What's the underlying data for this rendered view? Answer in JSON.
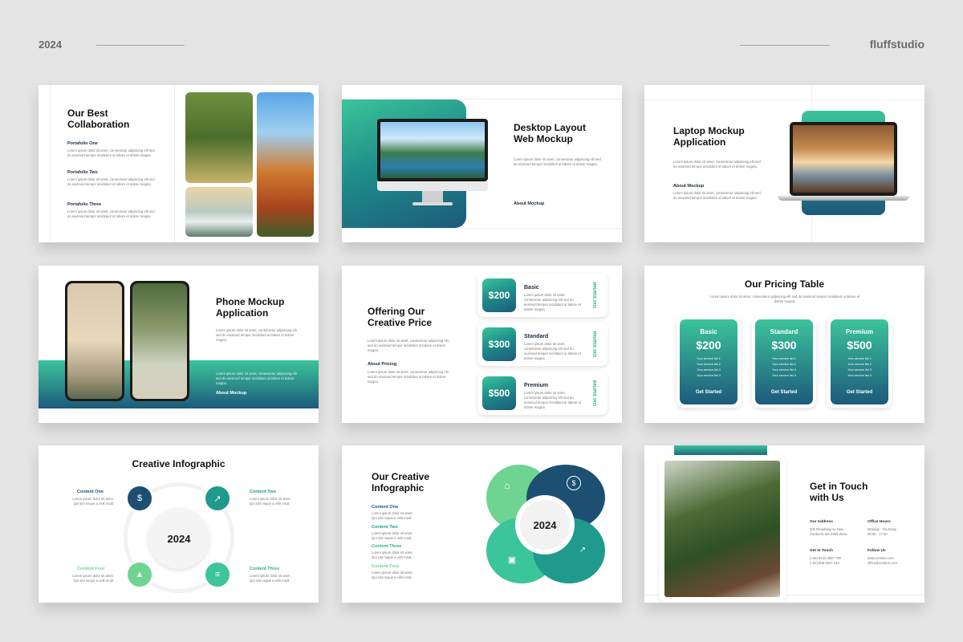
{
  "header": {
    "year": "2024",
    "brand": "fluffstudio"
  },
  "colors": {
    "teal": "#1f8f8a",
    "green": "#3cc49b",
    "navy": "#1d4f73",
    "light_green": "#6fd391"
  },
  "lorem": {
    "short": "Lorem ipsum dolor sit amet, consectetur adipiscing elit sed do eiusmod tempor incididunt ut labore et dolore magna.",
    "two": "Lorem ipsum dolor sit amet.\nQui sint neque a velit modi."
  },
  "s1": {
    "title": "Our Best\nCollaboration",
    "items": [
      {
        "name": "Portafolio One"
      },
      {
        "name": "Portafolio Two"
      },
      {
        "name": "Portafolio Three"
      }
    ]
  },
  "s2": {
    "title": "Desktop Layout\nWeb Mockup",
    "link": "About Mockup"
  },
  "s3": {
    "title": "Laptop Mockup\nApplication",
    "sub": "About Mockup"
  },
  "s4": {
    "title": "Phone Mockup\nApplication",
    "link": "About Mockup"
  },
  "s5": {
    "title": "Offering Our\nCreative Price",
    "sub": "About Pricing",
    "cards": [
      {
        "price": "$200",
        "name": "Basic",
        "cta": "Get Started"
      },
      {
        "price": "$300",
        "name": "Standard",
        "cta": "Get Started"
      },
      {
        "price": "$500",
        "name": "Premium",
        "cta": "Get Started"
      }
    ]
  },
  "s6": {
    "title": "Our Pricing Table",
    "plans": [
      {
        "name": "Basic",
        "price": "$200",
        "cta": "Get Started"
      },
      {
        "name": "Standard",
        "price": "$300",
        "cta": "Get Started"
      },
      {
        "name": "Premium",
        "price": "$500",
        "cta": "Get Started"
      }
    ],
    "features": [
      "Your service list 1",
      "Your service list 2",
      "Your service list 3",
      "Your service list 4"
    ]
  },
  "s7": {
    "title": "Creative Infographic",
    "center": "2024",
    "items": [
      {
        "name": "Content One"
      },
      {
        "name": "Content Two"
      },
      {
        "name": "Content Three"
      },
      {
        "name": "Content Four"
      }
    ]
  },
  "s8": {
    "title": "Our Creative\nInfographic",
    "center": "2024",
    "items": [
      {
        "name": "Content One"
      },
      {
        "name": "Content Two"
      },
      {
        "name": "Content Three"
      },
      {
        "name": "Content Four"
      }
    ]
  },
  "s9": {
    "title": "Get in Touch\nwith Us",
    "address_label": "Our Address",
    "address": "205 Broadway Av New\nCanberra WA 5656 West",
    "hours_label": "Office Hours",
    "hours": "Monday - Thursday\n08:00 - 17:00",
    "touch_label": "Get In Touch",
    "phones": "(+62) 8123 4567 790\n(+62) 808 4567 123",
    "follow_label": "Follow Us",
    "follow": "www.crealon.com\noffice@crealon.com"
  }
}
